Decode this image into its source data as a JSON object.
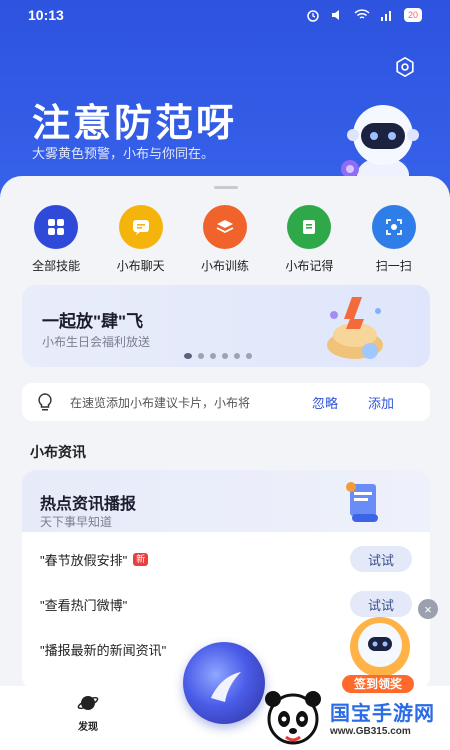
{
  "status": {
    "time": "10:13",
    "battery": "20"
  },
  "hero": {
    "title": "注意防范呀",
    "subtitle": "大雾黄色预警，小布与你同在。"
  },
  "quick_actions": [
    {
      "label": "全部技能",
      "icon": "grid-icon",
      "color": "#2f4ad8"
    },
    {
      "label": "小布聊天",
      "icon": "chat-icon",
      "color": "#f5b40c"
    },
    {
      "label": "小布训练",
      "icon": "layers-icon",
      "color": "#f0642c"
    },
    {
      "label": "小布记得",
      "icon": "notes-icon",
      "color": "#2fa84a"
    },
    {
      "label": "扫一扫",
      "icon": "scan-icon",
      "color": "#2f7de8"
    }
  ],
  "banner": {
    "title": "一起放\"肆\"飞",
    "subtitle": "小布生日会福利放送",
    "dots": 6,
    "active_dot": 0
  },
  "suggest": {
    "text": "在速览添加小布建议卡片，小布将",
    "ignore": "忽略",
    "add": "添加"
  },
  "section_title": "小布资讯",
  "news": {
    "title": "热点资讯播报",
    "subtitle": "天下事早知道",
    "rows": [
      {
        "text": "\"春节放假安排\"",
        "badge": "新",
        "action": "试试"
      },
      {
        "text": "\"查看热门微博\"",
        "action": "试试"
      },
      {
        "text": "\"播报最新的新闻资讯\""
      }
    ]
  },
  "nav": {
    "discover": "发现"
  },
  "promo": {
    "label": "签到领奖",
    "close": "×"
  },
  "watermark": {
    "title": "国宝手游网",
    "url": "www.GB315.com"
  },
  "colors": {
    "primary": "#2f56e0",
    "link": "#2c55d8",
    "badge": "#e84040"
  }
}
